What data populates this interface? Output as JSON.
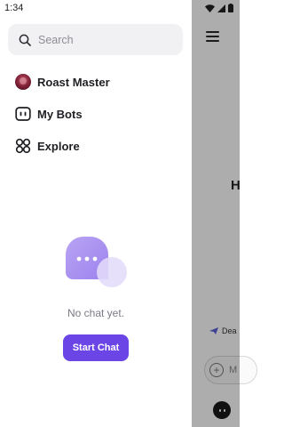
{
  "status_bar": {
    "time": "1:34"
  },
  "drawer": {
    "search": {
      "placeholder": "Search"
    },
    "nav": [
      {
        "label": "Roast Master",
        "icon": "bot-avatar"
      },
      {
        "label": "My Bots",
        "icon": "bot-face-icon"
      },
      {
        "label": "Explore",
        "icon": "explore-grid-icon"
      }
    ],
    "empty_state": {
      "message": "No chat yet.",
      "button_label": "Start Chat"
    }
  },
  "background": {
    "heading_fragment": "H",
    "row_fragment": "Dea",
    "input_fragment": "M"
  },
  "colors": {
    "accent": "#6b45e6",
    "illustration_light": "#c9b9f5",
    "illustration_mid": "#a48df0"
  }
}
